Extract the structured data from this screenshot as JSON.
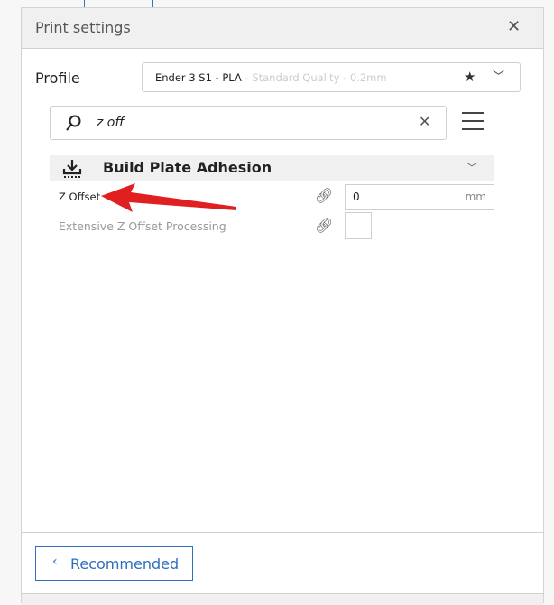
{
  "panel": {
    "title": "Print settings"
  },
  "profile": {
    "label": "Profile",
    "printer": "Ender 3 S1 - PLA",
    "quality": " - Standard Quality - 0.2mm"
  },
  "search": {
    "value": "z off"
  },
  "category": {
    "title": "Build Plate Adhesion"
  },
  "settings": [
    {
      "label": "Z Offset",
      "value": "0",
      "unit": "mm"
    },
    {
      "label": "Extensive Z Offset Processing",
      "checked": false
    }
  ],
  "footer": {
    "recommended_label": "Recommended"
  },
  "colors": {
    "accent": "#2e6dbf",
    "annotation_arrow": "#e02020"
  }
}
